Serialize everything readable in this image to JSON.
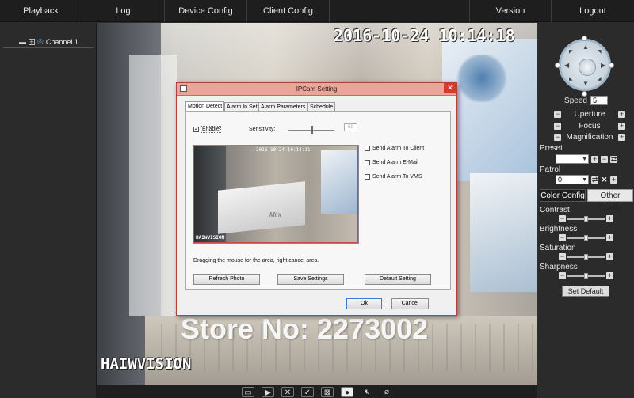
{
  "menu": {
    "items": [
      "Playback",
      "Log",
      "Device Config",
      "Client Config",
      "Version",
      "Logout"
    ]
  },
  "channels": {
    "items": [
      {
        "label": "Channel 1"
      }
    ]
  },
  "video": {
    "timestamp": "2016-10-24  10:14:18",
    "camera_brand": "HAIWVISION",
    "watermark": "Store No: 2273002"
  },
  "bottom_toolbar": {
    "icons": [
      "monitor-icon",
      "play-icon",
      "stop-icon",
      "record-icon",
      "close-all-icon",
      "snapshot-icon",
      "mute-icon",
      "talk-icon"
    ]
  },
  "ptz": {
    "speed_label": "Speed",
    "speed_value": "5",
    "uperture_label": "Uperture",
    "focus_label": "Focus",
    "magnification_label": "Magnification",
    "preset_label": "Preset",
    "preset_value": "",
    "patrol_label": "Patrol",
    "patrol_value": "0"
  },
  "config": {
    "tabs": [
      "Color Config",
      "Other Config"
    ],
    "sliders": [
      {
        "label": "Contrast",
        "level": 0.5
      },
      {
        "label": "Brightness",
        "level": 0.5
      },
      {
        "label": "Saturation",
        "level": 0.5
      },
      {
        "label": "Sharpness",
        "level": 0.5
      }
    ],
    "set_default_label": "Set Default"
  },
  "dialog": {
    "title": "IPCam Setting",
    "tabs": [
      "Motion Detect",
      "Alarm In Set",
      "Alarm Parameters",
      "Schedule"
    ],
    "enable_label": "Enable",
    "enable_checked": true,
    "sensitivity_label": "Sensitivity:",
    "sensitivity_value": "50",
    "sensitivity_level": 0.5,
    "preview_timestamp": "2016-10-24 10:14:11",
    "preview_brand": "HAIWVISION",
    "alarms": [
      {
        "label": "Send Alarm To Client",
        "checked": false
      },
      {
        "label": "Send Alarm E-Mail",
        "checked": false
      },
      {
        "label": "Send Alarm To VMS",
        "checked": false
      }
    ],
    "hint": "Dragging the mouse for the area, right cancel area.",
    "buttons": {
      "refresh": "Refresh Photo",
      "save": "Save Settings",
      "default": "Default Setting",
      "ok": "Ok",
      "cancel": "Cancel"
    }
  },
  "colors": {
    "dialog_title_bg": "#e9a59a",
    "close_button": "#d63b2f",
    "panel_bg": "#2b2b2b",
    "topbar_bg": "#1e1e1e"
  }
}
